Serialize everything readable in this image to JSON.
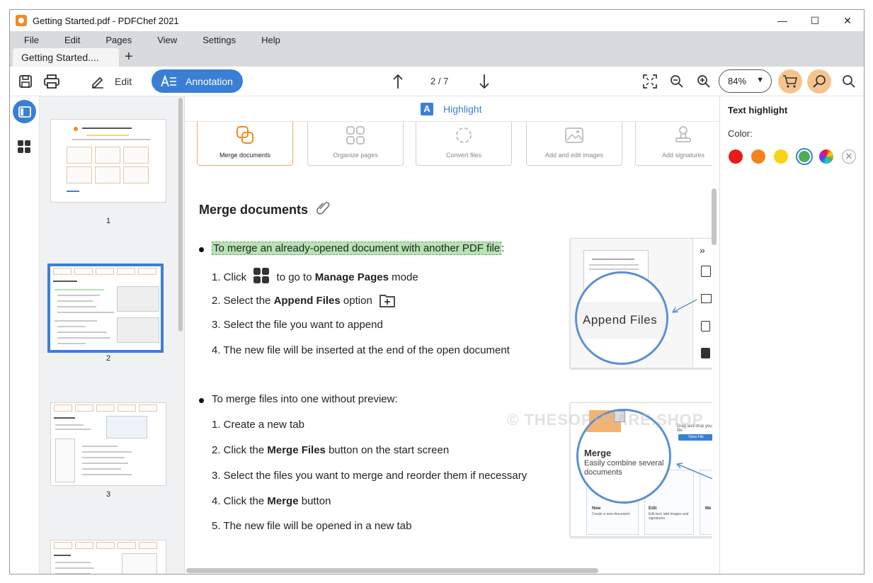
{
  "window": {
    "title": "Getting Started.pdf - PDFChef 2021"
  },
  "menu": [
    "File",
    "Edit",
    "Pages",
    "View",
    "Settings",
    "Help"
  ],
  "tab": {
    "label": "Getting Started...."
  },
  "toolbar": {
    "edit_label": "Edit",
    "annotation_label": "Annotation",
    "page_indicator": "2 / 7",
    "zoom": "84%"
  },
  "thumbnails": [
    {
      "num": "1"
    },
    {
      "num": "2",
      "selected": true
    },
    {
      "num": "3"
    }
  ],
  "annotation_bar": {
    "badge": "A",
    "label": "Highlight"
  },
  "cards": [
    "Merge documents",
    "Organize pages",
    "Convert files",
    "Add and edit images",
    "Add signatures"
  ],
  "doc": {
    "heading": "Merge documents",
    "section1": {
      "intro": "To merge an already-opened document with another PDF file",
      "intro_tail": ":",
      "step1_pre": "1. Click",
      "step1_mid": "to go to",
      "step1_bold": "Manage Pages",
      "step1_post": "mode",
      "step2_pre": "2. Select the",
      "step2_bold": "Append Files",
      "step2_post": "option",
      "step3": "3. Select the file you want to append",
      "step4": "4. The new file will be inserted at the end of the open document"
    },
    "section2": {
      "intro": "To merge files into one without preview:",
      "step1": "1. Create a new tab",
      "step2_pre": "2. Click the",
      "step2_bold": "Merge Files",
      "step2_post": "button on the start screen",
      "step3": "3. Select the files you want to merge and reorder them if necessary",
      "step4_pre": "4. Click the",
      "step4_bold": "Merge",
      "step4_post": "button",
      "step5": "5. The new file will be opened in a new tab"
    },
    "shot1": {
      "magnify_label": "Append Files"
    },
    "shot2": {
      "magnify_title": "Merge",
      "magnify_sub": "Easily combine several documents",
      "drop_text": "Drag and drop your file",
      "open_btn": "Open File",
      "col_new": "New",
      "col_new_sub": "Create a new document",
      "col_edit": "Edit",
      "col_edit_sub": "Edit text, add images and signatures",
      "col_more": "Me"
    },
    "watermark": "© THESOFTWARE.SHOP"
  },
  "right_panel": {
    "title": "Text highlight",
    "color_label": "Color:",
    "swatches": [
      "#e81b1b",
      "#f5821f",
      "#f7d417",
      "#4caf50"
    ]
  }
}
